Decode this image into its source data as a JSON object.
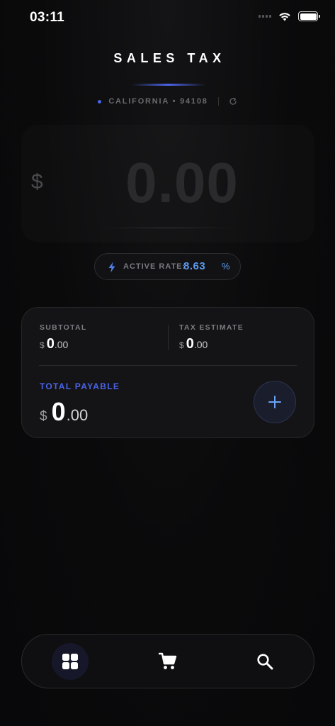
{
  "status_bar": {
    "time": "03:11",
    "icons": [
      "signal-icon",
      "wifi-icon",
      "battery-icon"
    ]
  },
  "header": {
    "title": "SALES TAX",
    "location": "CALIFORNIA • 94108",
    "refresh_icon": "refresh-icon"
  },
  "amount": {
    "currency": "$",
    "value": "0.00"
  },
  "rate": {
    "icon": "bolt-icon",
    "label": "ACTIVE RATE:",
    "value": "8.63",
    "unit": "%"
  },
  "summary": {
    "subtotal": {
      "label": "SUBTOTAL",
      "currency": "$",
      "integer": "0",
      "decimal": ".00"
    },
    "tax_estimate": {
      "label": "TAX ESTIMATE",
      "currency": "$",
      "integer": "0",
      "decimal": ".00"
    },
    "total": {
      "label": "TOTAL PAYABLE",
      "currency": "$",
      "integer": "0",
      "decimal": ".00"
    },
    "add_icon": "plus-icon"
  },
  "nav": {
    "items": [
      {
        "icon": "grid-icon",
        "active": true
      },
      {
        "icon": "cart-icon",
        "active": false
      },
      {
        "icon": "search-icon",
        "active": false
      }
    ]
  },
  "colors": {
    "accent": "#4b63e6",
    "rate_value": "#5b9bf0",
    "background": "#0a0a0b",
    "card": "#141416"
  }
}
